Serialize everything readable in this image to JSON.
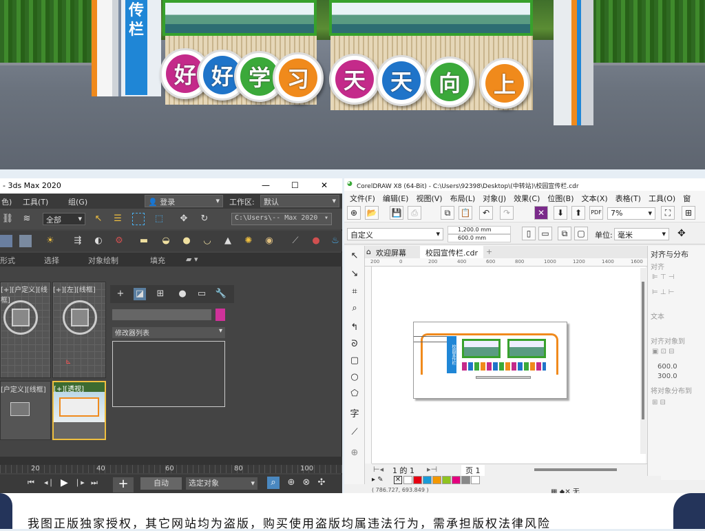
{
  "scene": {
    "sign_vertical_chars": "传栏",
    "slogan_chars": [
      {
        "char": "好",
        "color": "#c42a8a"
      },
      {
        "char": "好",
        "color": "#1f74c9"
      },
      {
        "char": "学",
        "color": "#3ba93a"
      },
      {
        "char": "习",
        "color": "#f08a1c"
      },
      {
        "char": "天",
        "color": "#c42a8a"
      },
      {
        "char": "天",
        "color": "#1f74c9"
      },
      {
        "char": "向",
        "color": "#3ba93a"
      },
      {
        "char": "上",
        "color": "#f08a1c"
      }
    ]
  },
  "max": {
    "title": "- 3ds Max 2020",
    "window_controls": [
      "—",
      "☐",
      "✕"
    ],
    "menus": [
      "色)",
      "工具(T)",
      "组(G)"
    ],
    "login": "登录",
    "workspace_label": "工作区:",
    "workspace_value": "默认",
    "selection_filter": "全部",
    "path": "C:\\Users\\-- Max 2020",
    "ribbon_tabs": [
      "形式",
      "选择",
      "对象绘制",
      "填充"
    ],
    "viewports": {
      "top_left": "[+][户定义][线框]",
      "top_right": "[+][左][线框]",
      "bottom_left": "[户定义][线框]",
      "bottom_right": "[+][透视]"
    },
    "modifier_list": "修改器列表",
    "timeline_ticks": [
      "20",
      "40",
      "60",
      "80",
      "100"
    ],
    "auto_key": "自动",
    "set_key": "选定对象"
  },
  "cdr": {
    "title": "CorelDRAW X8 (64-Bit) - C:\\Users\\92398\\Desktop\\(中转站)\\校园宣传栏.cdr",
    "menus": [
      "文件(F)",
      "编辑(E)",
      "视图(V)",
      "布局(L)",
      "对象(J)",
      "效果(C)",
      "位图(B)",
      "文本(X)",
      "表格(T)",
      "工具(O)",
      "窗"
    ],
    "zoom": "7%",
    "page_preset": "自定义",
    "width_value": "1,200.0 mm",
    "height_value": "600.0 mm",
    "unit_label": "单位:",
    "unit_value": "毫米",
    "tab_welcome": "欢迎屏幕",
    "tab_doc": "校园宣传栏.cdr",
    "ruler_ticks": [
      "200",
      "0",
      "200",
      "400",
      "600",
      "800",
      "1000",
      "1200",
      "1400",
      "1600"
    ],
    "dock_title": "对齐与分布",
    "dock_align": "对齐",
    "dock_text": "文本",
    "dock_align_objects": "对齐对象到",
    "dock_distribute": "将对象分布到",
    "dock_x_value": "600.0",
    "dock_y_value": "300.0",
    "page_nav": "1 的 1",
    "page_tab": "页 1",
    "coords": "( 786.727, 693.849 )",
    "palette": [
      "#ffffff",
      "#e60012",
      "#1a9bd7",
      "#f39800",
      "#8fc31f",
      "#e4007f",
      "#888888",
      "#ffffff"
    ],
    "mini_sign_text": "校园宣传栏"
  },
  "footer": {
    "notice": "我图正版独家授权，其它网站均为盗版，购买使用盗版均属违法行为，需承担版权法律风险"
  }
}
